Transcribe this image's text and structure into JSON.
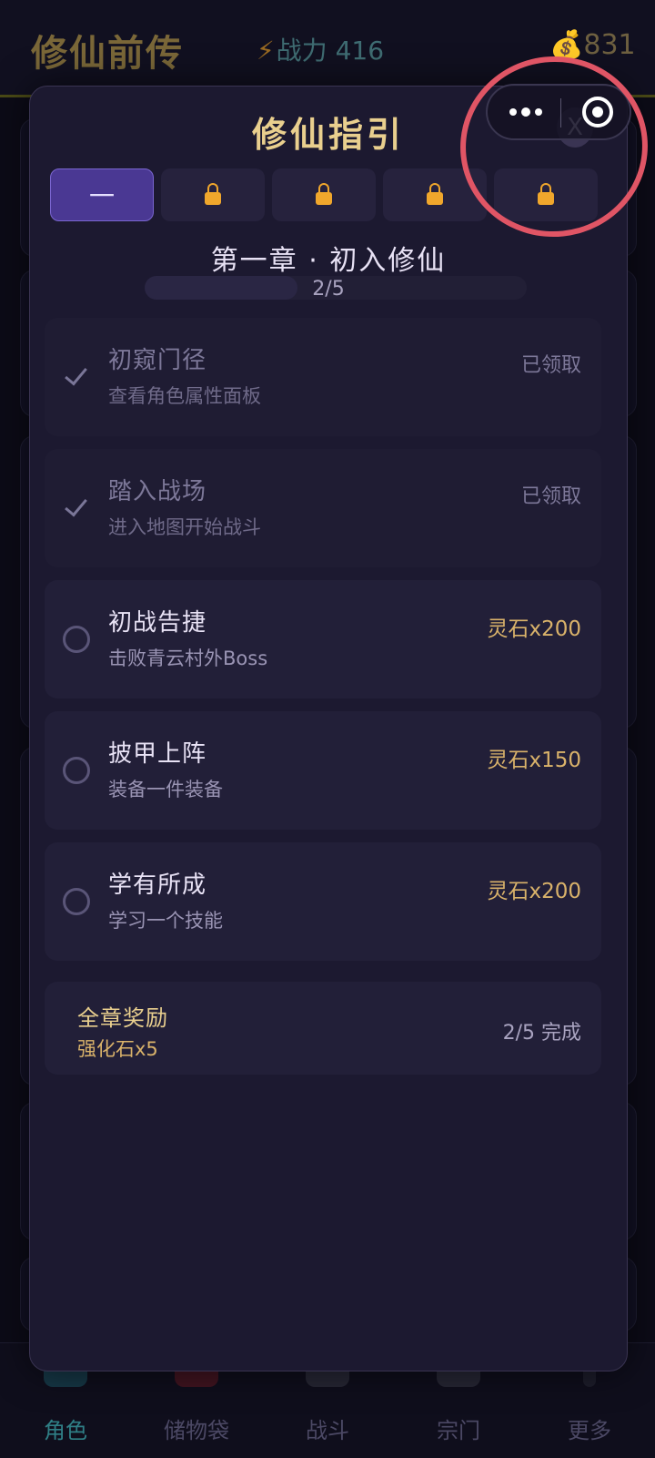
{
  "header": {
    "app_title": "修仙前传",
    "power_icon": "lightning-icon",
    "power_label": "战力",
    "power_value": "416",
    "gold_icon": "money-bag-icon",
    "gold_value": "831"
  },
  "bottom_nav": [
    {
      "label": "角色",
      "icon": "character-icon",
      "active": true
    },
    {
      "label": "储物袋",
      "icon": "bag-icon",
      "active": false
    },
    {
      "label": "战斗",
      "icon": "crossed-swords-icon",
      "active": false
    },
    {
      "label": "宗门",
      "icon": "pagoda-icon",
      "active": false
    },
    {
      "label": "更多",
      "icon": "more-icon",
      "active": false
    }
  ],
  "modal": {
    "title": "修仙指引",
    "close_label": "X",
    "tabs": [
      {
        "label": "一",
        "locked": false,
        "active": true
      },
      {
        "label": "",
        "locked": true,
        "active": false
      },
      {
        "label": "",
        "locked": true,
        "active": false
      },
      {
        "label": "",
        "locked": true,
        "active": false
      },
      {
        "label": "",
        "locked": true,
        "active": false
      }
    ],
    "chapter_title": "第一章 · 初入修仙",
    "chapter_progress": "2/5",
    "chapter_progress_fraction": 0.4,
    "tasks": [
      {
        "name": "初窥门径",
        "desc": "查看角色属性面板",
        "status": "已领取",
        "done": true
      },
      {
        "name": "踏入战场",
        "desc": "进入地图开始战斗",
        "status": "已领取",
        "done": true
      },
      {
        "name": "初战告捷",
        "desc": "击败青云村外Boss",
        "reward": "灵石x200",
        "done": false
      },
      {
        "name": "披甲上阵",
        "desc": "装备一件装备",
        "reward": "灵石x150",
        "done": false
      },
      {
        "name": "学有所成",
        "desc": "学习一个技能",
        "reward": "灵石x200",
        "done": false
      }
    ],
    "chapter_reward": {
      "label": "全章奖励",
      "item": "强化石x5",
      "status": "2/5 完成"
    }
  },
  "capsule": {
    "more_icon": "more-dots-icon",
    "close_icon": "target-close-icon"
  },
  "colors": {
    "accent_gold": "#e9cf8e",
    "reward_gold": "#d9b26a",
    "tab_active": "#4a3893",
    "lock": "#f0a72c",
    "annotation": "#e05565"
  }
}
